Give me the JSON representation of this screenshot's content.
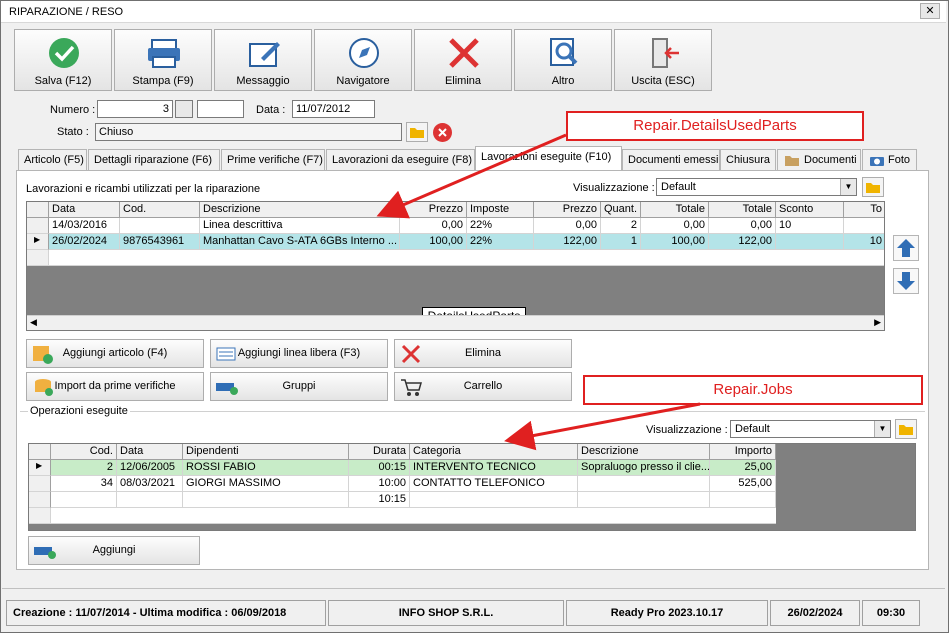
{
  "window": {
    "title": "RIPARAZIONE / RESO",
    "close_glyph": "✕"
  },
  "toolbar": [
    {
      "label": "Salva (F12)",
      "icon": "check-circle-icon"
    },
    {
      "label": "Stampa (F9)",
      "icon": "printer-icon"
    },
    {
      "label": "Messaggio",
      "icon": "message-icon"
    },
    {
      "label": "Navigatore",
      "icon": "compass-icon"
    },
    {
      "label": "Elimina",
      "icon": "red-x-icon"
    },
    {
      "label": "Altro",
      "icon": "magnifier-icon"
    },
    {
      "label": "Uscita (ESC)",
      "icon": "exit-door-icon"
    }
  ],
  "form": {
    "numero_label": "Numero :",
    "numero_value": "3",
    "data_label": "Data :",
    "data_value": "11/07/2012",
    "stato_label": "Stato :",
    "stato_value": "Chiuso"
  },
  "tabs": [
    "Articolo (F5)",
    "Dettagli riparazione (F6)",
    "Prime verifiche (F7)",
    "Lavorazioni da eseguire (F8)",
    "Lavorazioni eseguite  (F10)",
    "Documenti emessi",
    "Chiusura",
    "Documenti",
    "Foto"
  ],
  "active_tab": "Lavorazioni eseguite  (F10)",
  "parts": {
    "section_label": "Lavorazioni e ricambi utilizzati per la riparazione",
    "view_label": "Visualizzazione :",
    "view_value": "Default",
    "grid_name": "DetailsUsedParts",
    "columns": [
      "Data",
      "Cod.",
      "Descrizione",
      "Prezzo",
      "Imposte",
      "Prezzo",
      "Quant.",
      "Totale",
      "Totale",
      "Sconto",
      "To"
    ],
    "rows": [
      [
        "14/03/2016",
        "",
        "Linea descrittiva",
        "0,00",
        "22%",
        "0,00",
        "2",
        "0,00",
        "0,00",
        "10",
        ""
      ],
      [
        "26/02/2024",
        "9876543961",
        "Manhattan Cavo S-ATA 6GBs Interno ...",
        "100,00",
        "22%",
        "122,00",
        "1",
        "100,00",
        "122,00",
        "",
        "10"
      ]
    ],
    "buttons": [
      "Aggiungi articolo (F4)",
      "Aggiungi linea libera (F3)",
      "Elimina",
      "Import da prime verifiche",
      "Gruppi",
      "Carrello"
    ]
  },
  "jobs": {
    "section_label": "Operazioni eseguite",
    "view_label": "Visualizzazione :",
    "view_value": "Default",
    "columns": [
      "Cod.",
      "Data",
      "Dipendenti",
      "Durata",
      "Categoria",
      "Descrizione",
      "Importo"
    ],
    "rows": [
      [
        "2",
        "12/06/2005",
        "ROSSI FABIO",
        "00:15",
        "INTERVENTO TECNICO",
        "Sopraluogo presso il clie...",
        "25,00"
      ],
      [
        "34",
        "08/03/2021",
        "GIORGI MASSIMO",
        "10:00",
        "CONTATTO TELEFONICO",
        "",
        "525,00"
      ],
      [
        "",
        "",
        "",
        "10:15",
        "",
        "",
        ""
      ]
    ],
    "add_button": "Aggiungi"
  },
  "annotations": {
    "parts": "Repair.DetailsUsedParts",
    "jobs": "Repair.Jobs"
  },
  "status": {
    "created": "Creazione : 11/07/2014 - Ultima modifica : 06/09/2018",
    "company": "INFO SHOP S.R.L.",
    "product": "Ready Pro 2023.10.17",
    "date": "26/02/2024",
    "time": "09:30"
  },
  "colors": {
    "selected_row": "#b4e4e8",
    "job_selected_row": "#c8ecc8",
    "annotation": "#e02020",
    "grid_bg": "#808080"
  }
}
